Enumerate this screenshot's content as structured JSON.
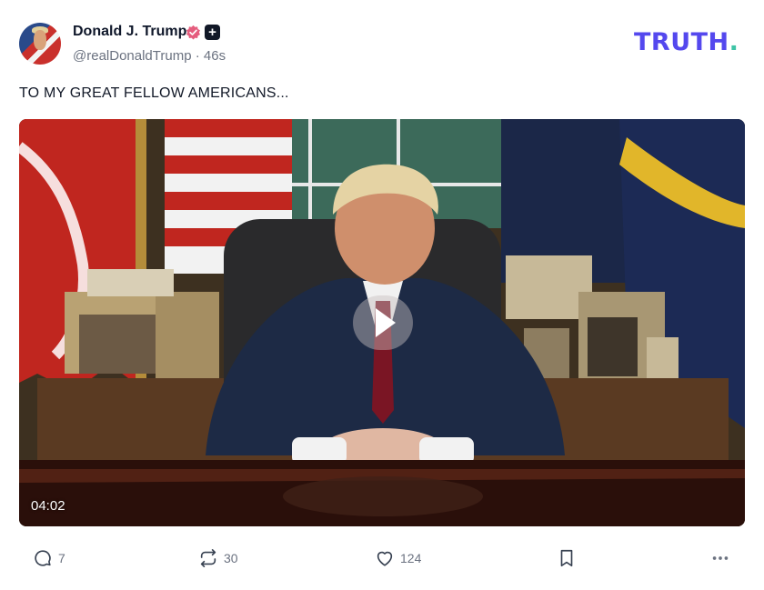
{
  "post": {
    "author_name": "Donald J. Trump",
    "handle": "@realDonaldTrump",
    "separator": "·",
    "time": "46s",
    "text": "TO MY GREAT FELLOW AMERICANS...",
    "verified_color": "#e55d7e"
  },
  "brand": {
    "logo": "TRUTH",
    "logo_dot": ".",
    "logo_color": "#5448ee",
    "dot_color": "#3ec4a6"
  },
  "video": {
    "duration": "04:02"
  },
  "actions": {
    "replies": "7",
    "retruths": "30",
    "likes": "124",
    "icons": [
      "reply-icon",
      "retruth-icon",
      "heart-icon",
      "bookmark-icon",
      "more-icon"
    ]
  }
}
